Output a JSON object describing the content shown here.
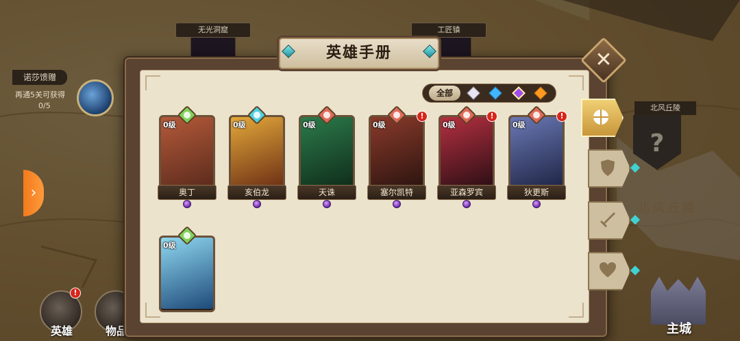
{
  "map": {
    "locations": [
      "无光洞窟",
      "工匠镇",
      "北风丘陵"
    ],
    "unknown_mark": "?",
    "handwriting": "北风丘陵",
    "quest": {
      "title": "诺莎馈赠",
      "desc": "再通5关可获得",
      "progress": "0/5"
    },
    "left_arrow": "›"
  },
  "bottom_nav": {
    "hero_label": "英雄",
    "items_label": "物品",
    "alert_mark": "!"
  },
  "main_city_label": "主城",
  "dialog": {
    "title": "英雄手册",
    "close_icon": "✕",
    "filter": {
      "all_label": "全部",
      "gems": [
        {
          "name": "white-gem",
          "color": "#e8e4f4"
        },
        {
          "name": "blue-gem",
          "color": "#3fb6ff"
        },
        {
          "name": "purple-gem",
          "color": "#a14bf0"
        },
        {
          "name": "orange-gem",
          "color": "#ff9a1f"
        }
      ]
    },
    "side_tabs": [
      "all-tab",
      "defense-tab",
      "attack-tab",
      "heal-tab"
    ],
    "heroes": [
      {
        "name": "奥丁",
        "level": "0级",
        "badge_color": "#7fd25a",
        "portrait": [
          "#b45a3a",
          "#5a2a1c"
        ],
        "alert": false
      },
      {
        "name": "亥伯龙",
        "level": "0级",
        "badge_color": "#4fd0e0",
        "portrait": [
          "#e3a83a",
          "#6b2e14"
        ],
        "alert": false
      },
      {
        "name": "天诛",
        "level": "0级",
        "badge_color": "#e06a5a",
        "portrait": [
          "#2c7a4a",
          "#0f2c1a"
        ],
        "alert": false
      },
      {
        "name": "塞尔凯特",
        "level": "0级",
        "badge_color": "#e06a5a",
        "portrait": [
          "#8a3a2a",
          "#2b1410"
        ],
        "alert": true
      },
      {
        "name": "亚森罗宾",
        "level": "0级",
        "badge_color": "#e06a5a",
        "portrait": [
          "#b43040",
          "#2a0e14"
        ],
        "alert": true
      },
      {
        "name": "狄更斯",
        "level": "0级",
        "badge_color": "#e06a5a",
        "portrait": [
          "#6a78b4",
          "#1e2444"
        ],
        "alert": true
      },
      {
        "name": "",
        "level": "0级",
        "badge_color": "#7fd25a",
        "portrait": [
          "#8fd8f0",
          "#1e4a7a"
        ],
        "alert": false
      }
    ],
    "alert_mark": "!"
  }
}
